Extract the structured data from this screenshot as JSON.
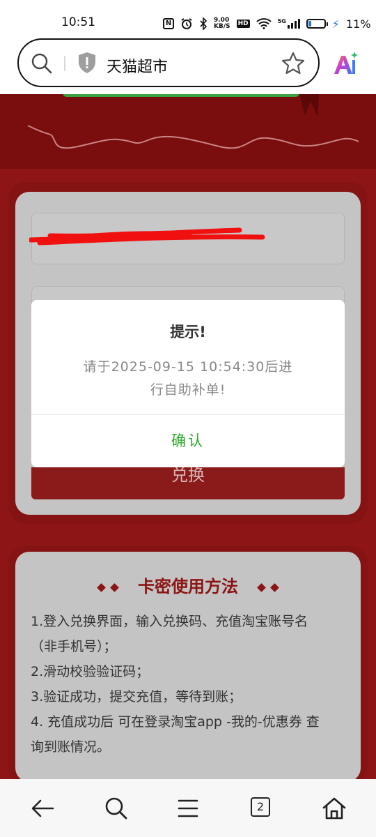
{
  "status_bar": {
    "time": "10:51",
    "speed_value": "9.00",
    "speed_unit": "KB/S",
    "hd": "HD",
    "net": "5G",
    "battery": "11%"
  },
  "address_bar": {
    "text": "天猫超市"
  },
  "form": {
    "exchange_button": "兑换"
  },
  "dialog": {
    "title": "提示!",
    "message_line1": "请于2025-09-15 10:54:30后进",
    "message_line2": "行自助补单!",
    "confirm": "确认"
  },
  "instructions": {
    "title": "卡密使用方法",
    "lines": [
      "1.登入兑换界面，输入兑换码、充值淘宝账号名",
      "（非手机号）；",
      "2.滑动校验验证码；",
      "3.验证成功，提交充值，等待到账；",
      "4. 充值成功后 可在登录淘宝app -我的-优惠券 查",
      "询到账情况。"
    ]
  },
  "bottom_nav": {
    "tab_count": "2"
  },
  "colors": {
    "page_red": "#8e1515",
    "card_gray": "#c4c4c4",
    "confirm_green": "#2fa82f",
    "title_red": "#8b1414"
  }
}
